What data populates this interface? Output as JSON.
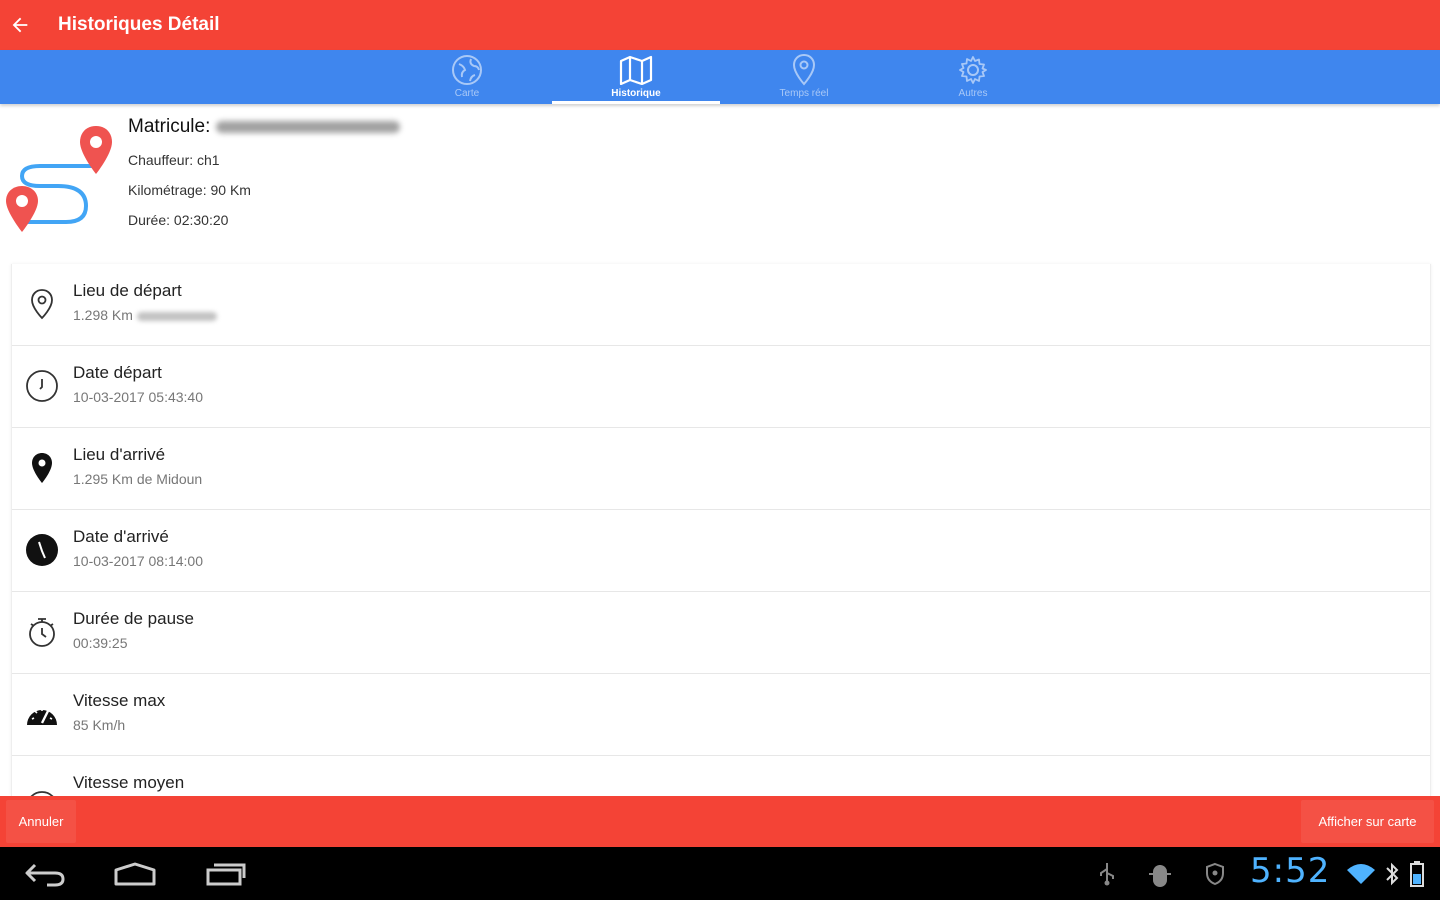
{
  "appbar": {
    "title": "Historiques Détail",
    "back_icon": "arrow-left-icon",
    "color": "#f44336"
  },
  "tabs": [
    {
      "label": "Carte",
      "icon": "globe-icon",
      "active": false
    },
    {
      "label": "Historique",
      "icon": "map-icon",
      "active": true
    },
    {
      "label": "Temps réel",
      "icon": "location-pin-icon",
      "active": false
    },
    {
      "label": "Autres",
      "icon": "gear-icon",
      "active": false
    }
  ],
  "summary": {
    "matricule_label": "Matricule:",
    "chauffeur": "Chauffeur: ch1",
    "kilometrage": "Kilométrage: 90 Km",
    "duree": "Durée: 02:30:20"
  },
  "rows": [
    {
      "label": "Lieu de départ",
      "value": "1.298 Km",
      "icon": "location-outline-icon"
    },
    {
      "label": "Date départ",
      "value": "10-03-2017 05:43:40",
      "icon": "clock-outline-icon"
    },
    {
      "label": "Lieu d'arrivé",
      "value": "1.295 Km de Midoun",
      "icon": "location-filled-icon"
    },
    {
      "label": "Date d'arrivé",
      "value": "10-03-2017 08:14:00",
      "icon": "clock-filled-icon"
    },
    {
      "label": "Durée de pause",
      "value": "00:39:25",
      "icon": "stopwatch-icon"
    },
    {
      "label": "Vitesse max",
      "value": "85 Km/h",
      "icon": "speedometer-icon"
    },
    {
      "label": "Vitesse moyen",
      "value": "",
      "icon": "speedometer-outline-icon"
    }
  ],
  "actions": {
    "cancel": "Annuler",
    "show_map": "Afficher sur carte"
  },
  "system": {
    "time": "5:52"
  },
  "colors": {
    "primary_red": "#f44336",
    "tab_blue": "#3f86ee",
    "pin_red": "#ef5350",
    "route_blue": "#42a5f5"
  }
}
